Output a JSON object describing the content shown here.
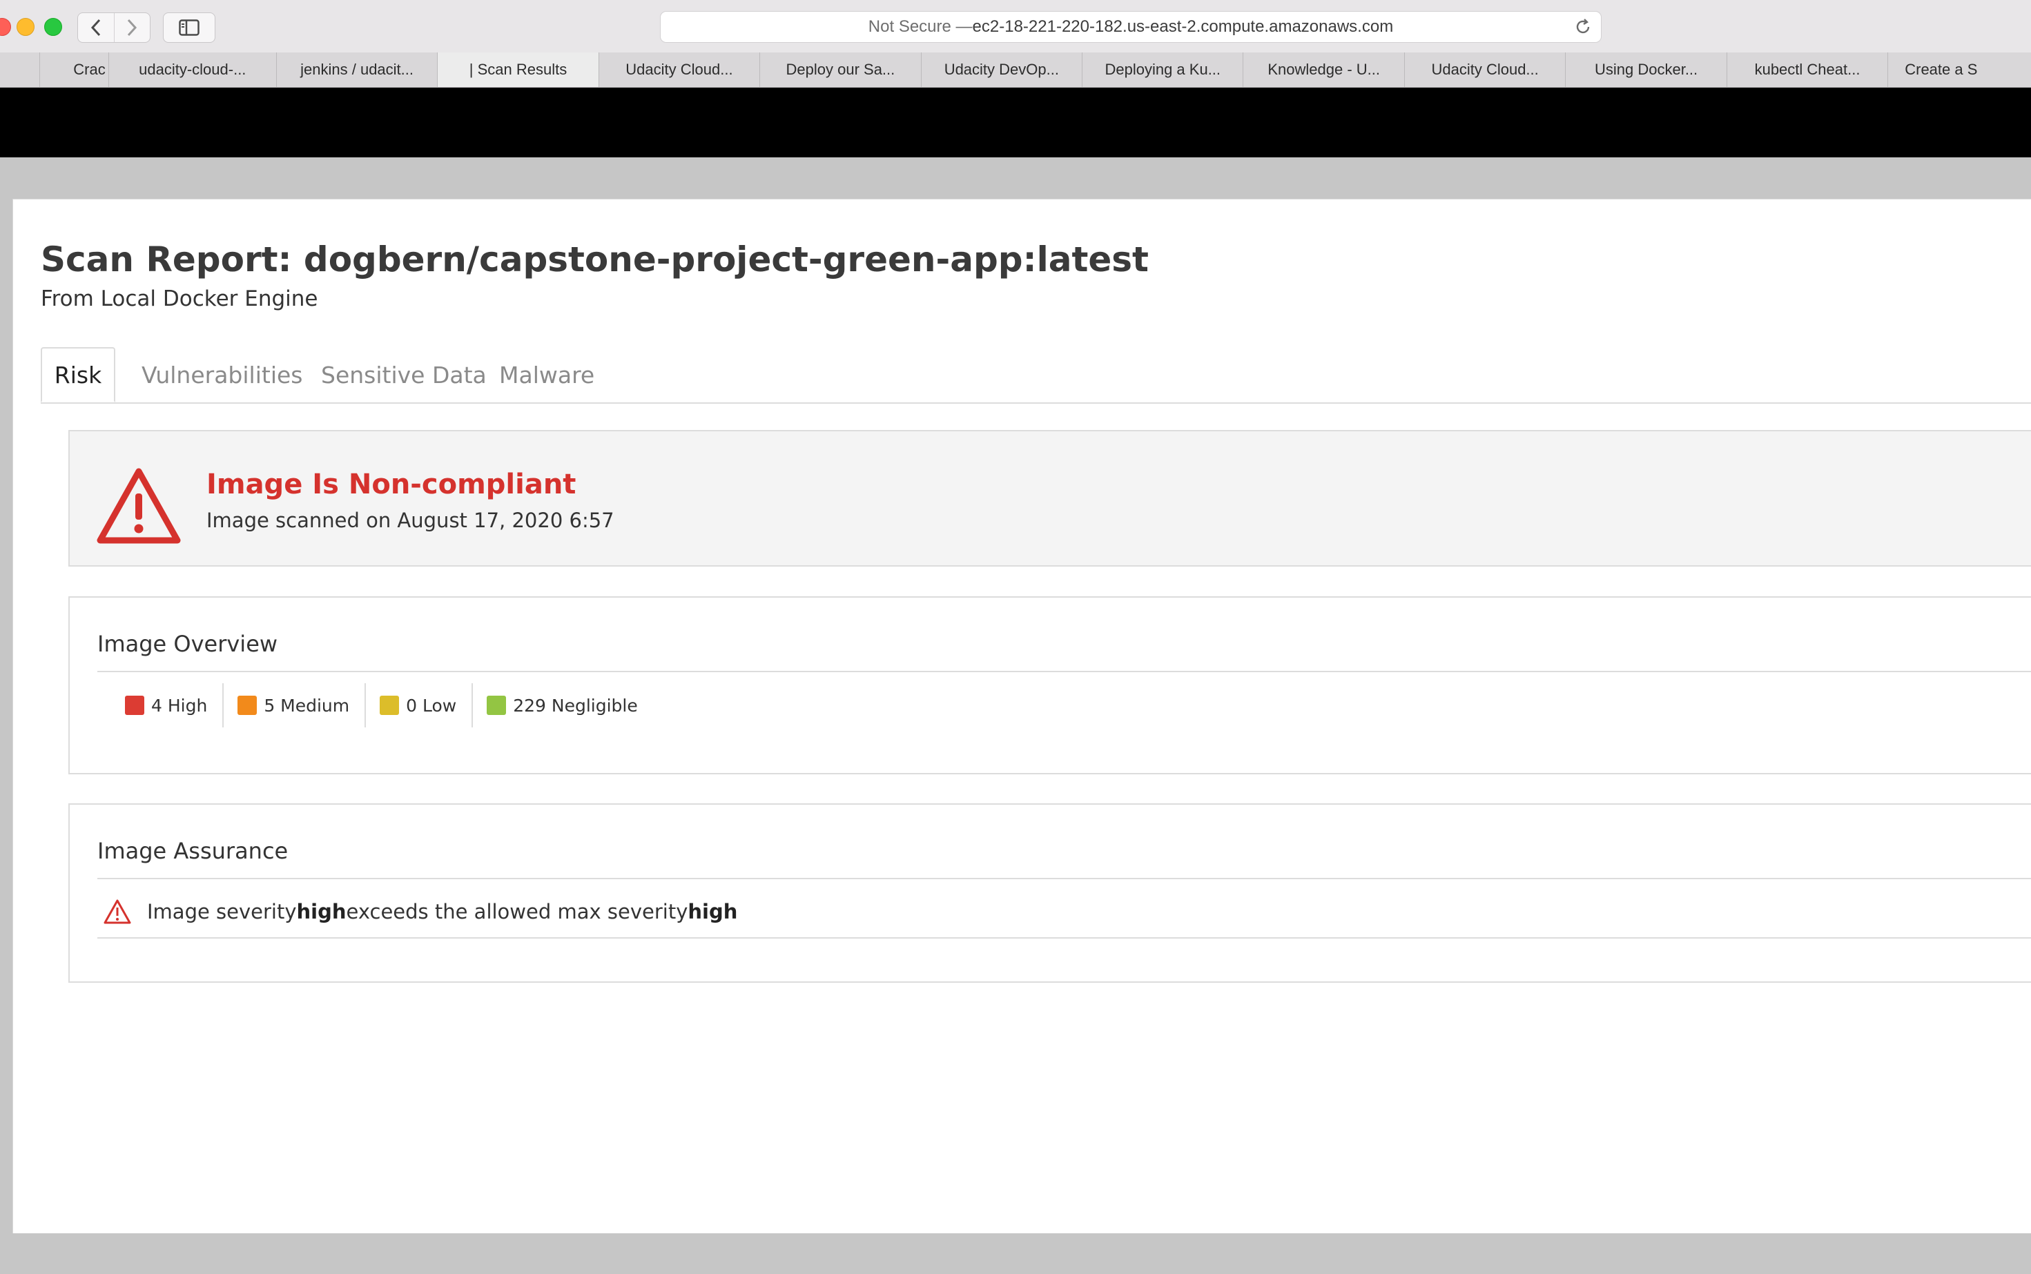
{
  "browser": {
    "url_prefix": "Not Secure — ",
    "url_host": "ec2-18-221-220-182.us-east-2.compute.amazonaws.com",
    "tabs": [
      {
        "label": "Crac"
      },
      {
        "label": "udacity-cloud-..."
      },
      {
        "label": "jenkins / udacit..."
      },
      {
        "label": "| Scan Results"
      },
      {
        "label": "Udacity Cloud..."
      },
      {
        "label": "Deploy our Sa..."
      },
      {
        "label": "Udacity DevOp..."
      },
      {
        "label": "Deploying a Ku..."
      },
      {
        "label": "Knowledge - U..."
      },
      {
        "label": "Udacity Cloud..."
      },
      {
        "label": "Using Docker..."
      },
      {
        "label": "kubectl Cheat..."
      },
      {
        "label": "Create a S"
      }
    ],
    "active_tab_index": 3
  },
  "report": {
    "title": "Scan Report: dogbern/capstone-project-green-app:latest",
    "subtitle": "From Local Docker Engine",
    "tabs": [
      "Risk",
      "Vulnerabilities",
      "Sensitive Data",
      "Malware"
    ],
    "active_tab": "Risk"
  },
  "compliance": {
    "title": "Image Is Non-compliant",
    "scanned": "Image scanned on August 17, 2020 6:57",
    "icon": "warning-triangle-icon",
    "color": "#d5322d"
  },
  "overview": {
    "title": "Image Overview",
    "severities": [
      {
        "label": "4 High",
        "color": "#dc3c33"
      },
      {
        "label": "5 Medium",
        "color": "#f28a1b"
      },
      {
        "label": "0 Low",
        "color": "#dcbd2a"
      },
      {
        "label": "229 Negligible",
        "color": "#93c543"
      }
    ]
  },
  "assurance": {
    "title": "Image Assurance",
    "text_1": "Image severity ",
    "bold_1": "high",
    "text_2": " exceeds the allowed max severity ",
    "bold_2": "high"
  }
}
